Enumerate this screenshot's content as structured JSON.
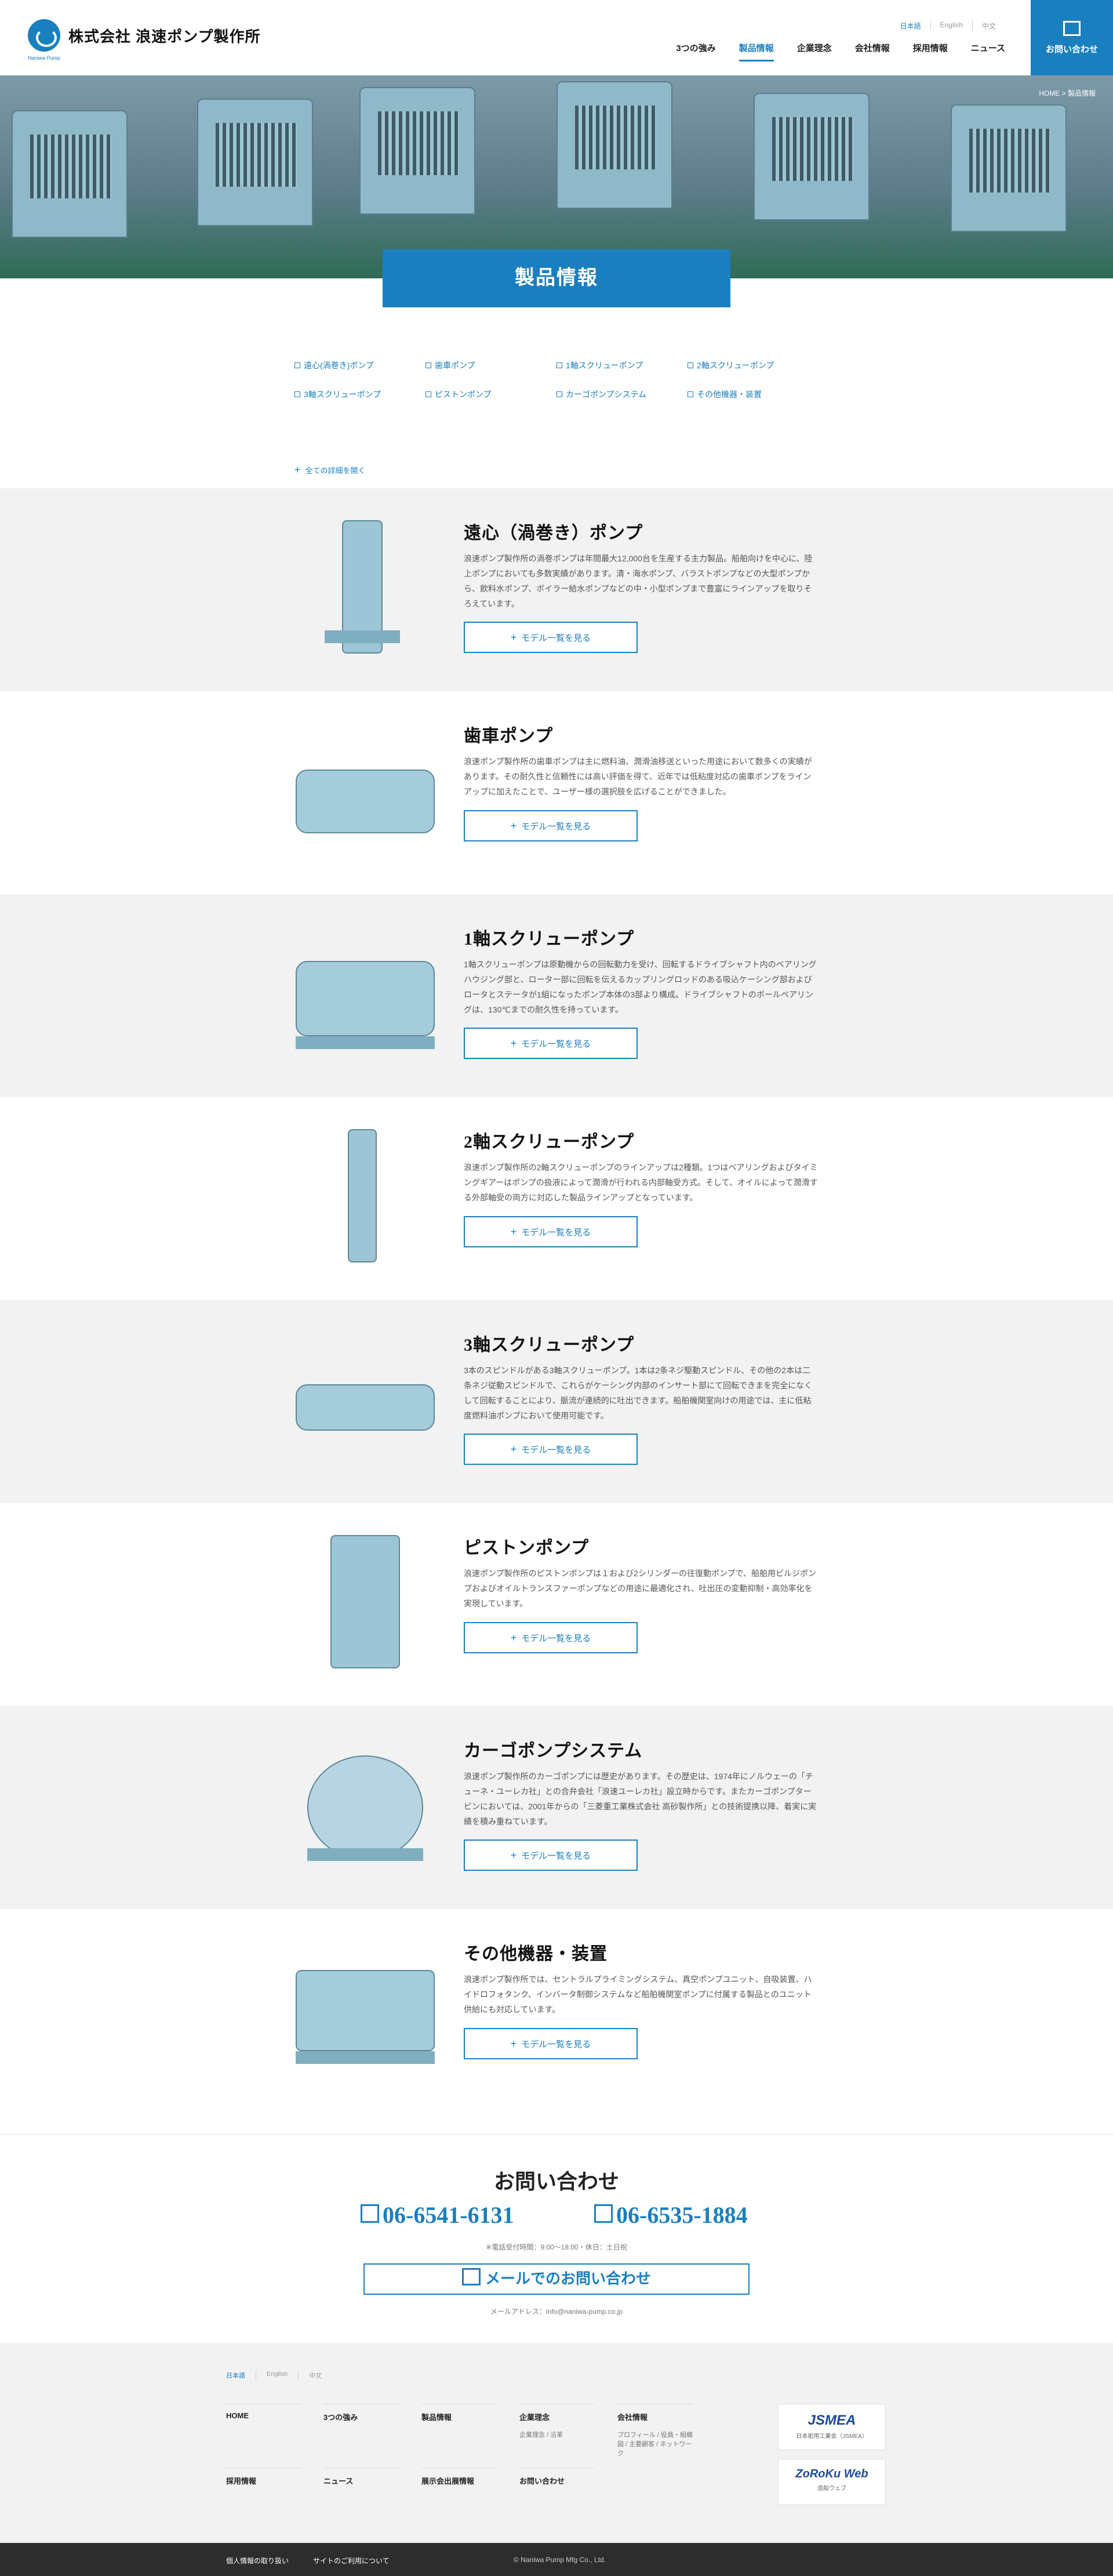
{
  "header": {
    "logo_text": "株式会社 浪速ポンプ製作所",
    "logo_sub": "Naniwa Pump",
    "languages": [
      "日本語",
      "English",
      "中文"
    ],
    "nav": [
      "3つの強み",
      "製品情報",
      "企業理念",
      "会社情報",
      "採用情報",
      "ニュース"
    ],
    "contact_label": "お問い合わせ"
  },
  "hero": {
    "breadcrumb": "HOME > 製品情報",
    "title": "製品情報"
  },
  "category_nav": {
    "items": [
      "遠心(渦巻き)ポンプ",
      "歯車ポンプ",
      "1軸スクリューポンプ",
      "2軸スクリューポンプ",
      "3軸スクリューポンプ",
      "ピストンポンプ",
      "カーゴポンプシステム",
      "その他機器・装置"
    ],
    "open_all": "全ての詳細を開く"
  },
  "products": [
    {
      "title": "遠心（渦巻き）ポンプ",
      "text": "浪速ポンプ製作所の渦巻ポンプは年間最大12,000台を生産する主力製品。船舶向けを中心に、陸上ポンプにおいても多数実績があります。清・海水ポンプ、バラストポンプなどの大型ポンプから、飲料水ポンプ、ボイラー給水ポンプなどの中・小型ポンプまで豊富にラインアップを取りそろえています。",
      "button": "モデル一覧を見る"
    },
    {
      "title": "歯車ポンプ",
      "text": "浪速ポンプ製作所の歯車ポンプは主に燃料油、潤滑油移送といった用途において数多くの実績があります。その耐久性と信頼性には高い評価を得て、近年では低粘度対応の歯車ポンプをラインアップに加えたことで、ユーザー様の選択肢を広げることができました。",
      "button": "モデル一覧を見る"
    },
    {
      "title": "1軸スクリューポンプ",
      "text": "1軸スクリューポンプは原動機からの回転動力を受け、回転するドライブシャフト内のベアリングハウジング部と、ローター部に回転を伝えるカップリングロッドのある吸込ケーシング部およびロータとステータが1組になったポンプ本体の3部より構成。ドライブシャフトのボールベアリングは、130℃までの耐久性を持っています。",
      "button": "モデル一覧を見る"
    },
    {
      "title": "2軸スクリューポンプ",
      "text": "浪速ポンプ製作所の2軸スクリューポンプのラインアップは2種類。1つはベアリングおよびタイミングギアーはポンプの扱液によって潤滑が行われる内部軸受方式。そして、オイルによって潤滑する外部軸受の両方に対応した製品ラインアップとなっています。",
      "button": "モデル一覧を見る"
    },
    {
      "title": "3軸スクリューポンプ",
      "text": "3本のスピンドルがある3軸スクリューポンプ。1本は2条ネジ駆動スピンドル、その他の2本は二条ネジ従動スピンドルで、これらがケーシング内部のインサート部にて回転できまを完全になくして回転することにより、脈流が連続的に吐出できます。船舶機関室向けの用途では、主に低粘度燃料油ポンプにおいて使用可能です。",
      "button": "モデル一覧を見る"
    },
    {
      "title": "ピストンポンプ",
      "text": "浪速ポンプ製作所のピストンポンプは１および2シリンダーの往復動ポンプで、船舶用ビルジポンプおよびオイルトランスファーポンプなどの用途に最適化され、吐出圧の変動抑制・高効率化を実現しています。",
      "button": "モデル一覧を見る"
    },
    {
      "title": "カーゴポンプシステム",
      "text": "浪速ポンプ製作所のカーゴポンプには歴史があります。その歴史は、1974年にノルウェーの「チューネ・ユーレカ社」との合弁会社「浪速ユーレカ社」設立時からです。またカーゴポンプタービンにおいては、2001年からの「三菱重工業株式会社 高砂製作所」との技術提携以降、着実に実績を積み重ねています。",
      "button": "モデル一覧を見る"
    },
    {
      "title": "その他機器・装置",
      "text": "浪速ポンプ製作所では、セントラルプライミングシステム、真空ポンプユニット、自吸装置、ハイドロフォタンク、インバータ制御システムなど船舶機関室ポンプに付属する製品とのユニット供給にも対応しています。",
      "button": "モデル一覧を見る"
    }
  ],
  "contact": {
    "title": "お問い合わせ",
    "tel1": "06-6541-6131",
    "tel2": "06-6535-1884",
    "hours": "※電話受付時間：9:00〜18:00・休日：土日祝",
    "mail_button": "メールでのお問い合わせ",
    "mail_address": "メールアドレス：info@naniwa-pump.co.jp"
  },
  "footer": {
    "languages": [
      "日本語",
      "English",
      "中文"
    ],
    "columns": [
      {
        "title": "HOME",
        "sub": ""
      },
      {
        "title": "3つの強み",
        "sub": ""
      },
      {
        "title": "製品情報",
        "sub": ""
      },
      {
        "title": "企業理念",
        "sub": "企業理念 / 沿革"
      },
      {
        "title": "会社情報",
        "sub": "プロフィール / 役員・組織図 / 主要顧客 / ネットワーク"
      },
      {
        "title": "採用情報",
        "sub": ""
      },
      {
        "title": "ニュース",
        "sub": ""
      },
      {
        "title": "展示会出展情報",
        "sub": ""
      },
      {
        "title": "お問い合わせ",
        "sub": ""
      }
    ],
    "banners": [
      {
        "brand": "JSMEA",
        "caption": "日本舶用工業会（JSMEA）"
      },
      {
        "brand": "ZoRoKu Web",
        "caption": "造船ウェブ"
      }
    ]
  },
  "bottom": {
    "privacy": "個人情報の取り扱い",
    "terms": "サイトのご利用について",
    "copyright": "© Naniwa Pump Mfg Co., Ltd."
  }
}
